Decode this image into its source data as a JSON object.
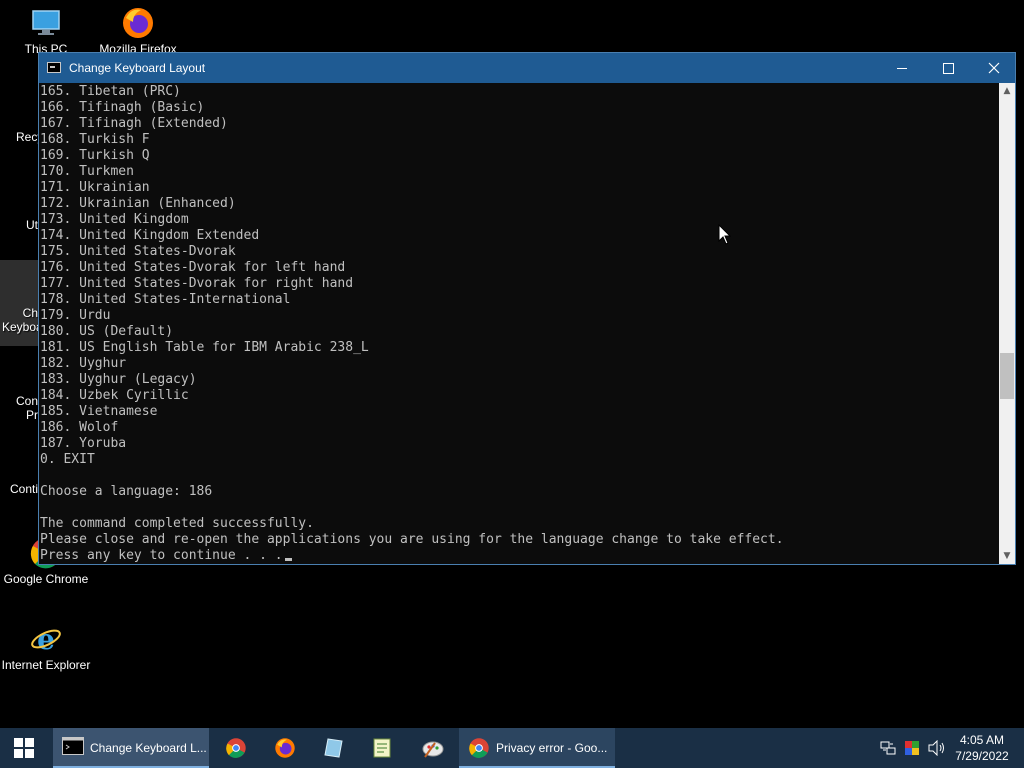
{
  "desktop": {
    "icons": [
      {
        "label": "This PC"
      },
      {
        "label": "Mozilla Firefox"
      },
      {
        "label": "Recy"
      },
      {
        "label": "Ut"
      },
      {
        "label": "Ch\nKeyboa"
      },
      {
        "label": "Con\nPr"
      },
      {
        "label": "Conti"
      },
      {
        "label": "Google Chrome"
      },
      {
        "label": "Internet Explorer"
      }
    ]
  },
  "window": {
    "title": "Change Keyboard Layout",
    "accent": "#1f5b93"
  },
  "console": {
    "lines": [
      "165. Tibetan (PRC)",
      "166. Tifinagh (Basic)",
      "167. Tifinagh (Extended)",
      "168. Turkish F",
      "169. Turkish Q",
      "170. Turkmen",
      "171. Ukrainian",
      "172. Ukrainian (Enhanced)",
      "173. United Kingdom",
      "174. United Kingdom Extended",
      "175. United States-Dvorak",
      "176. United States-Dvorak for left hand",
      "177. United States-Dvorak for right hand",
      "178. United States-International",
      "179. Urdu",
      "180. US (Default)",
      "181. US English Table for IBM Arabic 238_L",
      "182. Uyghur",
      "183. Uyghur (Legacy)",
      "184. Uzbek Cyrillic",
      "185. Vietnamese",
      "186. Wolof",
      "187. Yoruba",
      "0. EXIT",
      "",
      "Choose a language: 186",
      "",
      "The command completed successfully.",
      "Please close and re-open the applications you are using for the language change to take effect.",
      "Press any key to continue . . ."
    ]
  },
  "taskbar": {
    "tasks": [
      {
        "label": "Change Keyboard L..."
      },
      {
        "label": "Privacy error - Goo..."
      }
    ],
    "clock": {
      "time": "4:05 AM",
      "date": "7/29/2022"
    }
  }
}
